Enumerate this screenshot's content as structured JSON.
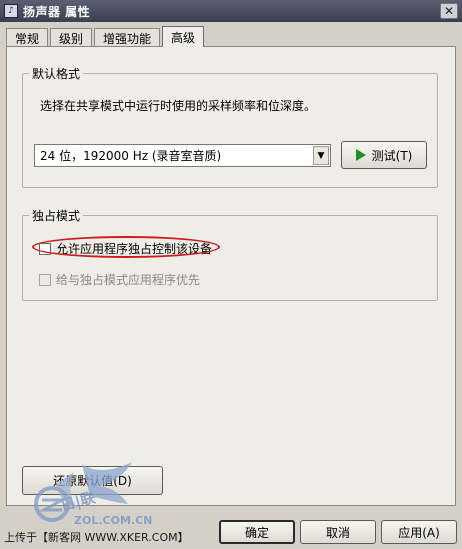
{
  "window": {
    "title": "扬声器 属性",
    "icon": "speaker-icon",
    "close_glyph": "✕"
  },
  "tabs": [
    {
      "label": "常规",
      "active": false
    },
    {
      "label": "级别",
      "active": false
    },
    {
      "label": "增强功能",
      "active": false
    },
    {
      "label": "高级",
      "active": true
    }
  ],
  "default_format": {
    "group_label": "默认格式",
    "description": "选择在共享模式中运行时使用的采样频率和位深度。",
    "selected_format": "24 位，192000 Hz (录音室音质)",
    "test_button": "测试(T)"
  },
  "exclusive_mode": {
    "group_label": "独占模式",
    "allow_exclusive": {
      "label": "允许应用程序独占控制该设备",
      "checked": false
    },
    "give_priority": {
      "label": "给与独占模式应用程序优先",
      "checked": false,
      "disabled": true
    }
  },
  "restore_defaults_button": "还原默认值(D)",
  "footer": {
    "ok_button": "确定",
    "cancel_button": "取消",
    "apply_button": "应用(A)"
  },
  "watermark": {
    "site": "ZOL.COM.CN",
    "upload_note": "上传于【新客网 WWW.XKER.COM】"
  },
  "colors": {
    "highlight": "#cf1a1a",
    "titlebar": "#3b3f52",
    "play_icon": "#1f8d2a"
  }
}
